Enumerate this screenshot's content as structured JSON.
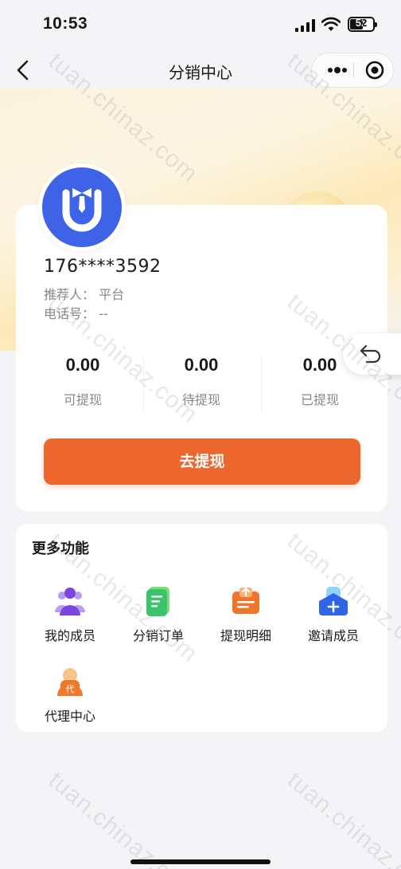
{
  "status_bar": {
    "time": "10:53",
    "battery": "52"
  },
  "nav": {
    "title": "分销中心"
  },
  "profile": {
    "phone": "176****3592",
    "referrer_label": "推荐人：",
    "referrer_value": "平台",
    "tel_label": "电话号：",
    "tel_value": "--"
  },
  "stats": [
    {
      "value": "0.00",
      "label": "可提现"
    },
    {
      "value": "0.00",
      "label": "待提现"
    },
    {
      "value": "0.00",
      "label": "已提现"
    }
  ],
  "withdraw_button": "去提现",
  "functions": {
    "title": "更多功能",
    "items": [
      {
        "label": "我的成员",
        "icon": "members-icon"
      },
      {
        "label": "分销订单",
        "icon": "order-icon"
      },
      {
        "label": "提现明细",
        "icon": "withdraw-detail-icon"
      },
      {
        "label": "邀请成员",
        "icon": "invite-icon"
      },
      {
        "label": "代理中心",
        "icon": "agent-icon"
      }
    ]
  },
  "watermark": "tuan.chinaz.com",
  "colors": {
    "accent": "#ec672d",
    "avatar_bg": "#3f63e6"
  }
}
